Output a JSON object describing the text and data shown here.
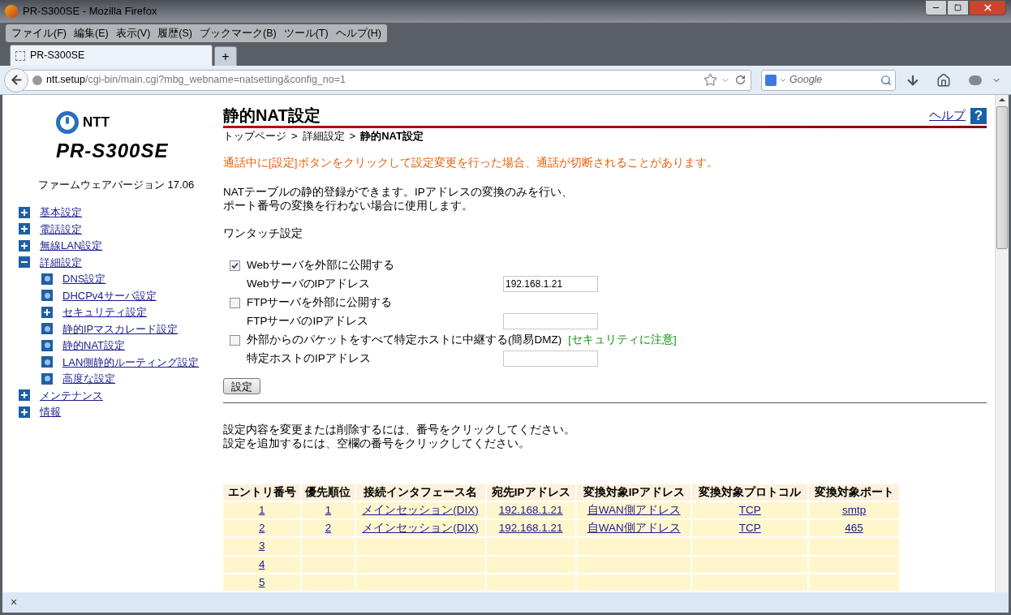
{
  "window": {
    "title": "PR-S300SE - Mozilla Firefox"
  },
  "menu": [
    "ファイル(F)",
    "編集(E)",
    "表示(V)",
    "履歴(S)",
    "ブックマーク(B)",
    "ツール(T)",
    "ヘルプ(H)"
  ],
  "tabs": [
    {
      "label": "PR-S300SE",
      "selected": true
    }
  ],
  "new_tab": "+",
  "address": {
    "host": "ntt.setup",
    "path": "/cgi-bin/main.cgi?mbg_webname=natsetting&config_no=1"
  },
  "search": {
    "placeholder": "Google"
  },
  "sidebar": {
    "logo_brand": "NTT",
    "logo_model": "PR-S300SE",
    "firmware": "ファームウェアバージョン 17.06",
    "items": [
      {
        "label": "基本設定",
        "kind": "group",
        "expanded": false
      },
      {
        "label": "電話設定",
        "kind": "group",
        "expanded": false
      },
      {
        "label": "無線LAN設定",
        "kind": "group",
        "expanded": false
      },
      {
        "label": "詳細設定",
        "kind": "group",
        "expanded": true,
        "children": [
          {
            "label": "DNS設定",
            "kind": "page"
          },
          {
            "label": "DHCPv4サーバ設定",
            "kind": "page"
          },
          {
            "label": "セキュリティ設定",
            "kind": "group",
            "expanded": false
          },
          {
            "label": "静的IPマスカレード設定",
            "kind": "page"
          },
          {
            "label": "静的NAT設定",
            "kind": "page"
          },
          {
            "label": "LAN側静的ルーティング設定",
            "kind": "page"
          },
          {
            "label": "高度な設定",
            "kind": "page"
          }
        ]
      },
      {
        "label": "メンテナンス",
        "kind": "group",
        "expanded": false
      },
      {
        "label": "情報",
        "kind": "group",
        "expanded": false
      }
    ]
  },
  "page": {
    "title": "静的NAT設定",
    "help": "ヘルプ",
    "help_icon": "?",
    "breadcrumb": [
      {
        "label": "トップページ",
        "current": false
      },
      {
        "label": "詳細設定",
        "current": false
      },
      {
        "label": "静的NAT設定",
        "current": true
      }
    ],
    "separator": ">",
    "warning": "通話中に[設定]ボタンをクリックして設定変更を行った場合、通話が切断されることがあります。",
    "description": [
      "NATテーブルの静的登録ができます。IPアドレスの変換のみを行い、",
      "ポート番号の変換を行わない場合に使用します。"
    ],
    "one_touch": {
      "heading": "ワンタッチ設定",
      "options": [
        {
          "label": "Webサーバを外部に公開する",
          "checked": true,
          "field_label": "WebサーバのIPアドレス",
          "value": "192.168.1.21"
        },
        {
          "label": "FTPサーバを外部に公開する",
          "checked": false,
          "field_label": "FTPサーバのIPアドレス"
        },
        {
          "label": "外部からのパケットをすべて特定ホストに中継する(簡易DMZ)",
          "note": "[セキュリティに注意]",
          "checked": false,
          "field_label": "特定ホストのIPアドレス"
        }
      ],
      "button": "設定"
    },
    "instructions": [
      "設定内容を変更または削除するには、番号をクリックしてください。",
      "設定を追加するには、空欄の番号をクリックしてください。"
    ],
    "table": {
      "columns": [
        "エントリ番号",
        "優先順位",
        "接続インタフェース名",
        "宛先IPアドレス",
        "変換対象IPアドレス",
        "変換対象プロトコル",
        "変換対象ポート"
      ],
      "rows": [
        [
          "1",
          "1",
          "メインセッション(DIX)",
          "192.168.1.21",
          "自WAN側アドレス",
          "TCP",
          "smtp"
        ],
        [
          "2",
          "2",
          "メインセッション(DIX)",
          "192.168.1.21",
          "自WAN側アドレス",
          "TCP",
          "465"
        ],
        [
          "3",
          "",
          "",
          "",
          "",
          "",
          ""
        ],
        [
          "4",
          "",
          "",
          "",
          "",
          "",
          ""
        ],
        [
          "5",
          "",
          "",
          "",
          "",
          "",
          ""
        ]
      ]
    }
  },
  "status_bar": {
    "close": "×"
  }
}
